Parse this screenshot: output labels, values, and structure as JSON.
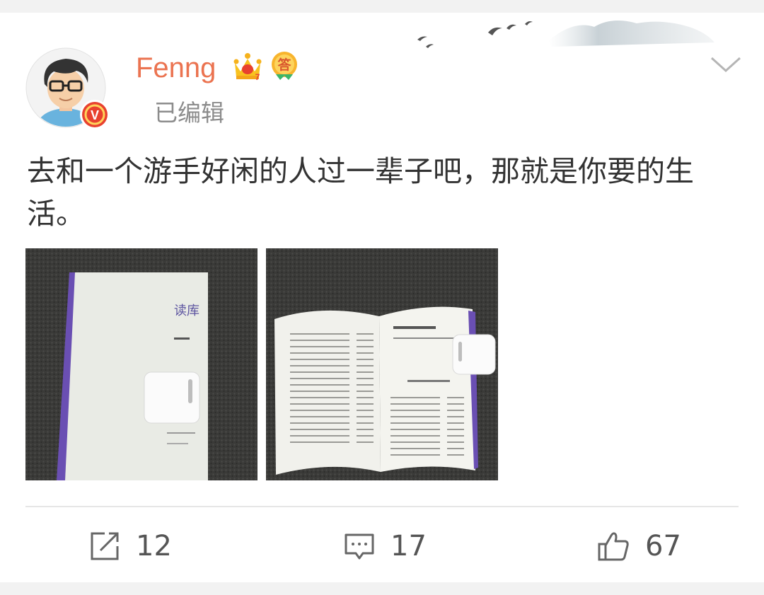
{
  "post": {
    "username": "Fenng",
    "status": "已编辑",
    "text": "去和一个游手好闲的人过一辈子吧，那就是你要的生活。",
    "badges": [
      "crown-vip-icon",
      "answer-badge-icon"
    ],
    "badge_answer_text": "答",
    "verified_mark": "V",
    "images": [
      {
        "name": "photo-book-cover",
        "book_title": "读库"
      },
      {
        "name": "photo-open-book"
      }
    ]
  },
  "actions": {
    "repost_count": "12",
    "comment_count": "17",
    "like_count": "67"
  },
  "colors": {
    "username": "#eb7350",
    "verified": "#e8412f",
    "text": "#333333",
    "meta": "#8c8c8c",
    "book_spine": "#6a4fb3"
  }
}
